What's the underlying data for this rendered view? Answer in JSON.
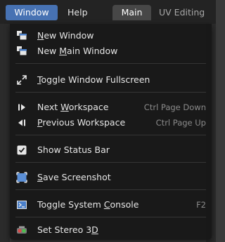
{
  "topbar": {
    "window_label": "Window",
    "help_label": "Help",
    "main_tab_label": "Main",
    "uv_tab_label": "UV Editing"
  },
  "menu": {
    "new_window": {
      "pre": "",
      "ul": "N",
      "post": "ew Window",
      "icon": "new-window-icon"
    },
    "new_main_window": {
      "pre": "New ",
      "ul": "M",
      "post": "ain Window",
      "icon": "new-main-window-icon"
    },
    "toggle_fullscreen": {
      "pre": "",
      "ul": "T",
      "post": "oggle Window Fullscreen",
      "icon": "fullscreen-icon"
    },
    "next_workspace": {
      "pre": "Next ",
      "ul": "W",
      "post": "orkspace",
      "shortcut": "Ctrl Page Down",
      "icon": "next-icon"
    },
    "previous_workspace": {
      "pre": "",
      "ul": "P",
      "post": "revious Workspace",
      "shortcut": "Ctrl Page Up",
      "icon": "previous-icon"
    },
    "show_status_bar": {
      "label": "Show Status Bar",
      "icon": "checkbox-checked-icon"
    },
    "save_screenshot": {
      "pre": "",
      "ul": "S",
      "post": "ave Screenshot",
      "icon": "screenshot-icon"
    },
    "toggle_system_console": {
      "pre": "Toggle System ",
      "ul": "C",
      "post": "onsole",
      "shortcut": "F2",
      "icon": "console-icon"
    },
    "set_stereo_3d": {
      "pre": "Set Stereo 3",
      "ul": "D",
      "post": "",
      "icon": "stereo-3d-icon"
    }
  },
  "colors": {
    "accent": "#4772b3",
    "menu_bg": "#181818",
    "text": "#e6e6e6",
    "shortcut_text": "#8a8a8a"
  }
}
